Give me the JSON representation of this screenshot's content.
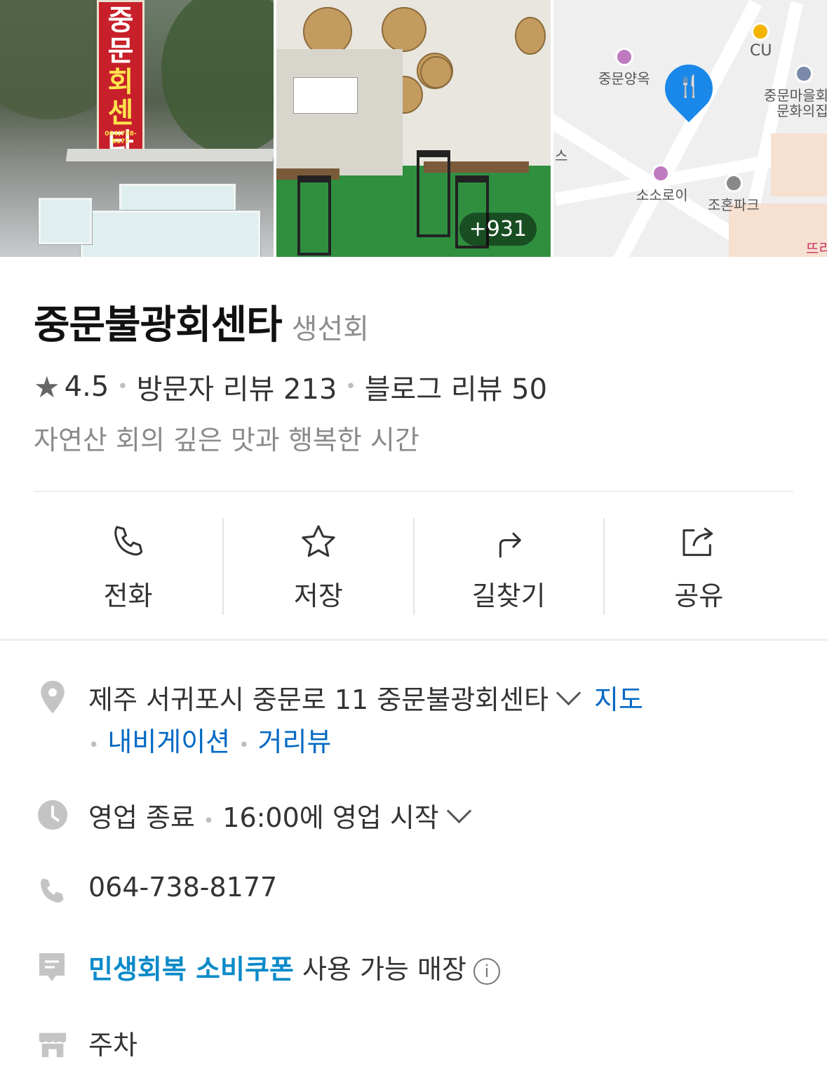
{
  "photos": {
    "sign_text": [
      "중",
      "문",
      "회",
      "센",
      "타"
    ],
    "sign_small": "불광",
    "sign_phone": "064)738-8177",
    "more_count": "+931"
  },
  "map": {
    "pois": [
      "중문양옥",
      "CU",
      "중문마을회",
      "문화의집",
      "소소로이",
      "조혼파크",
      "뜨리",
      "스"
    ]
  },
  "place": {
    "name": "중문불광회센타",
    "category": "생선회",
    "rating": "4.5",
    "visitor_reviews": "방문자 리뷰 213",
    "blog_reviews": "블로그 리뷰 50",
    "description": "자연산 회의 깊은 맛과 행복한 시간"
  },
  "actions": {
    "call": "전화",
    "save": "저장",
    "directions": "길찾기",
    "share": "공유"
  },
  "info": {
    "address": "제주 서귀포시 중문로 11 중문불광회센타",
    "map_link": "지도",
    "navigation_link": "내비게이션",
    "streetview_link": "거리뷰",
    "hours_status": "영업 종료",
    "hours_next": "16:00에 영업 시작",
    "phone": "064-738-8177",
    "coupon_highlight": "민생회복 소비쿠폰",
    "coupon_text": "사용 가능 매장",
    "parking": "주차"
  },
  "colors": {
    "link": "#0068c3",
    "coupon": "#0a8ac9",
    "pin": "#1a88e8"
  }
}
